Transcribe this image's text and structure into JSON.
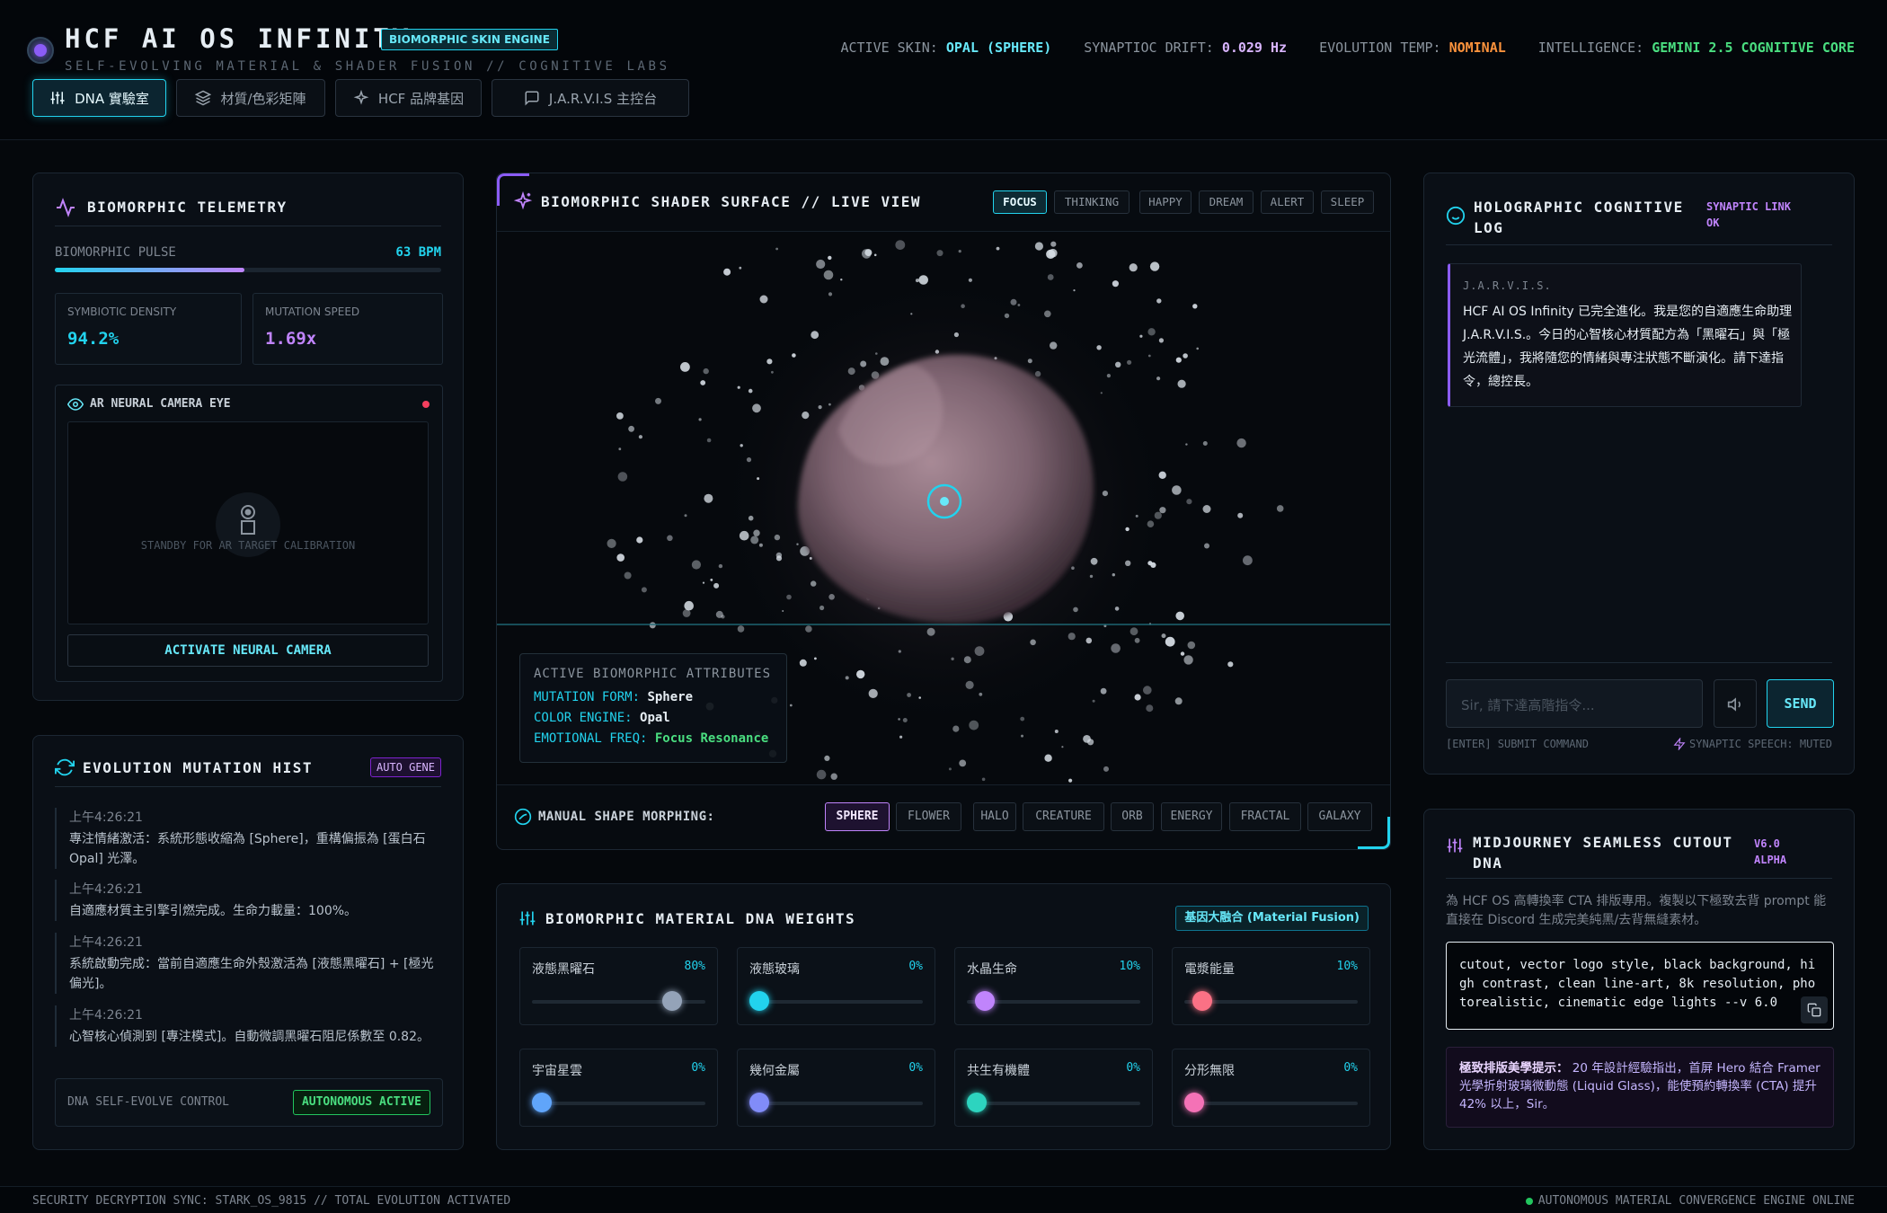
{
  "header": {
    "title": "HCF AI OS INFINITY",
    "badge": "BIOMORPHIC SKIN ENGINE",
    "subtitle": "SELF-EVOLVING MATERIAL & SHADER FUSION // COGNITIVE LABS",
    "nav": [
      {
        "label": "DNA 實驗室",
        "icon": "sliders-icon",
        "active": true
      },
      {
        "label": "材質/色彩矩陣",
        "icon": "layers-icon",
        "active": false
      },
      {
        "label": "HCF 品牌基因",
        "icon": "sparkle-icon",
        "active": false
      },
      {
        "label": "J.A.R.V.I.S 主控台",
        "icon": "chat-icon",
        "active": false
      }
    ],
    "stats": {
      "skin_label": "ACTIVE SKIN:",
      "skin_value": "OPAL (SPHERE)",
      "drift_label": "SYNAPTIOC DRIFT:",
      "drift_value": "0.029 Hz",
      "temp_label": "EVOLUTION TEMP:",
      "temp_value": "NOMINAL",
      "intel_label": "INTELLIGENCE:",
      "intel_value": "GEMINI 2.5 COGNITIVE CORE"
    }
  },
  "telemetry": {
    "title": "BIOMORPHIC TELEMETRY",
    "pulse_label": "BIOMORPHIC PULSE",
    "pulse_value": "63 BPM",
    "pulse_fraction": 0.49,
    "density_label": "SYMBIOTIC DENSITY",
    "density_value": "94.2%",
    "speed_label": "MUTATION SPEED",
    "speed_value": "1.69x",
    "camera_title": "AR NEURAL CAMERA EYE",
    "camera_standby": "STANDBY FOR AR TARGET CALIBRATION",
    "camera_button": "ACTIVATE NEURAL CAMERA"
  },
  "history": {
    "title": "EVOLUTION MUTATION HIST",
    "badge": "AUTO GENE",
    "items": [
      {
        "time": "上午4:26:21",
        "msg": "專注情緒激活：系統形態收縮為 [Sphere]，重構偏振為 [蛋白石 Opal] 光澤。"
      },
      {
        "time": "上午4:26:21",
        "msg": "自適應材質主引擎引燃完成。生命力載量：100%。"
      },
      {
        "time": "上午4:26:21",
        "msg": "系統啟動完成：當前自適應生命外殼激活為 [液態黑曜石] + [極光偏光]。"
      },
      {
        "time": "上午4:26:21",
        "msg": "心智核心偵測到 [專注模式]。自動微調黑曜石阻尼係數至 0.82。"
      }
    ],
    "control_label": "DNA SELF-EVOLVE CONTROL",
    "control_button": "AUTONOMOUS ACTIVE"
  },
  "shader": {
    "title": "BIOMORPHIC SHADER SURFACE // LIVE VIEW",
    "modes": [
      "FOCUS",
      "THINKING",
      "HAPPY",
      "DREAM",
      "ALERT",
      "SLEEP"
    ],
    "active_mode": "FOCUS",
    "attrs_title": "ACTIVE BIOMORPHIC ATTRIBUTES",
    "form_label": "MUTATION FORM:",
    "form_value": "Sphere",
    "color_label": "COLOR ENGINE:",
    "color_value": "Opal",
    "freq_label": "EMOTIONAL FREQ:",
    "freq_value": "Focus Resonance",
    "morph_label": "MANUAL SHAPE MORPHING:",
    "shapes": [
      "SPHERE",
      "FLOWER",
      "HALO",
      "CREATURE",
      "ORB",
      "ENERGY",
      "FRACTAL",
      "GALAXY"
    ],
    "active_shape": "SPHERE"
  },
  "dna": {
    "title": "BIOMORPHIC MATERIAL DNA WEIGHTS",
    "badge": "基因大融合 (Material Fusion)",
    "weights": [
      {
        "name": "液態黑曜石",
        "pct": "80%",
        "value": 0.8,
        "color": "#94a3b8"
      },
      {
        "name": "液態玻璃",
        "pct": "0%",
        "value": 0.0,
        "color": "#22d3ee"
      },
      {
        "name": "水晶生命",
        "pct": "10%",
        "value": 0.1,
        "color": "#c084fc"
      },
      {
        "name": "電漿能量",
        "pct": "10%",
        "value": 0.1,
        "color": "#fb7185"
      },
      {
        "name": "宇宙星雲",
        "pct": "0%",
        "value": 0.0,
        "color": "#60a5fa"
      },
      {
        "name": "幾何金屬",
        "pct": "0%",
        "value": 0.0,
        "color": "#818cf8"
      },
      {
        "name": "共生有機體",
        "pct": "0%",
        "value": 0.0,
        "color": "#2dd4bf"
      },
      {
        "name": "分形無限",
        "pct": "0%",
        "value": 0.0,
        "color": "#f472b6"
      }
    ]
  },
  "jarvis": {
    "title_line1": "HOLOGRAPHIC COGNITIVE",
    "title_line2": "LOG",
    "link_line1": "SYNAPTIC LINK",
    "link_line2": "OK",
    "sender": "J.A.R.V.I.S.",
    "message": "HCF AI OS Infinity 已完全進化。我是您的自適應生命助理 J.A.R.V.I.S.。今日的心智核心材質配方為「黑曜石」與「極光流體」，我將隨您的情緒與專注狀態不斷演化。請下達指令，總控長。",
    "input_placeholder": "Sir, 請下達高階指令...",
    "send": "SEND",
    "hint_left": "[ENTER] SUBMIT COMMAND",
    "hint_right": "SYNAPTIC SPEECH: MUTED"
  },
  "midjourney": {
    "title_line1": "MIDJOURNEY SEAMLESS CUTOUT",
    "title_line2": "DNA",
    "version_line1": "V6.0",
    "version_line2": "ALPHA",
    "desc": "為 HCF OS 高轉換率 CTA 排版專用。複製以下極致去背 prompt 能直接在 Discord 生成完美純黑/去背無縫素材。",
    "prompt": "cutout, vector logo style, black background, high contrast, clean line-art, 8k resolution, photorealistic, cinematic edge lights --v 6.0",
    "tip_label": "極致排版美學提示：",
    "tip_text": "20 年設計經驗指出，首屏 Hero 結合 Framer 光學折射玻璃微動態 (Liquid Glass)，能使預約轉換率 (CTA) 提升 42% 以上，Sir。"
  },
  "footer": {
    "left": "SECURITY DECRYPTION SYNC: STARK_OS_9815 // TOTAL EVOLUTION ACTIVATED",
    "right": "AUTONOMOUS MATERIAL CONVERGENCE ENGINE ONLINE"
  }
}
